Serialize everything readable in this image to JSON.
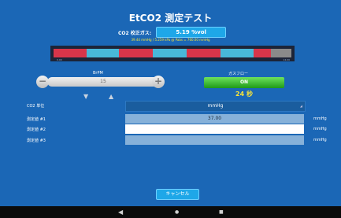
{
  "title": "EtCO2 測定テスト",
  "calibration": {
    "label": "CO2 校正ガス:",
    "value": "5.19 %vol",
    "sub": "39.44 mmHg / 5.259 kPa @ Pabs = 760.00 mmHg"
  },
  "band": {
    "left_tick": "0.00",
    "right_tick": "14.00",
    "segment_colors": [
      "#d8354a",
      "#48b8d9",
      "#d8354a",
      "#48b8d9",
      "#d8354a",
      "#48b8d9",
      "#d8354a",
      "#8a8a8a"
    ]
  },
  "brpm": {
    "label": "BrPM",
    "value": "15",
    "minus": "−",
    "plus": "+"
  },
  "gasflow": {
    "label": "ガスフロー",
    "state": "ON",
    "time": "24 秒"
  },
  "rows": [
    {
      "label": "CO2 単位",
      "value": "mmHg",
      "unit": ""
    },
    {
      "label": "測定値 #1",
      "value": "37.00",
      "unit": "mmHg"
    },
    {
      "label": "測定値 #2",
      "value": "",
      "unit": "mmHg"
    },
    {
      "label": "測定値 #3",
      "value": "",
      "unit": "mmHg"
    }
  ],
  "cancel_label": "キャンセル",
  "nav": {
    "back": "◀",
    "home": "●",
    "recent": "■"
  },
  "colors": {
    "background": "#1b67b6",
    "accent": "#1ea7e8",
    "on_green": "#2fb82a",
    "yellow": "#f6e23a"
  }
}
